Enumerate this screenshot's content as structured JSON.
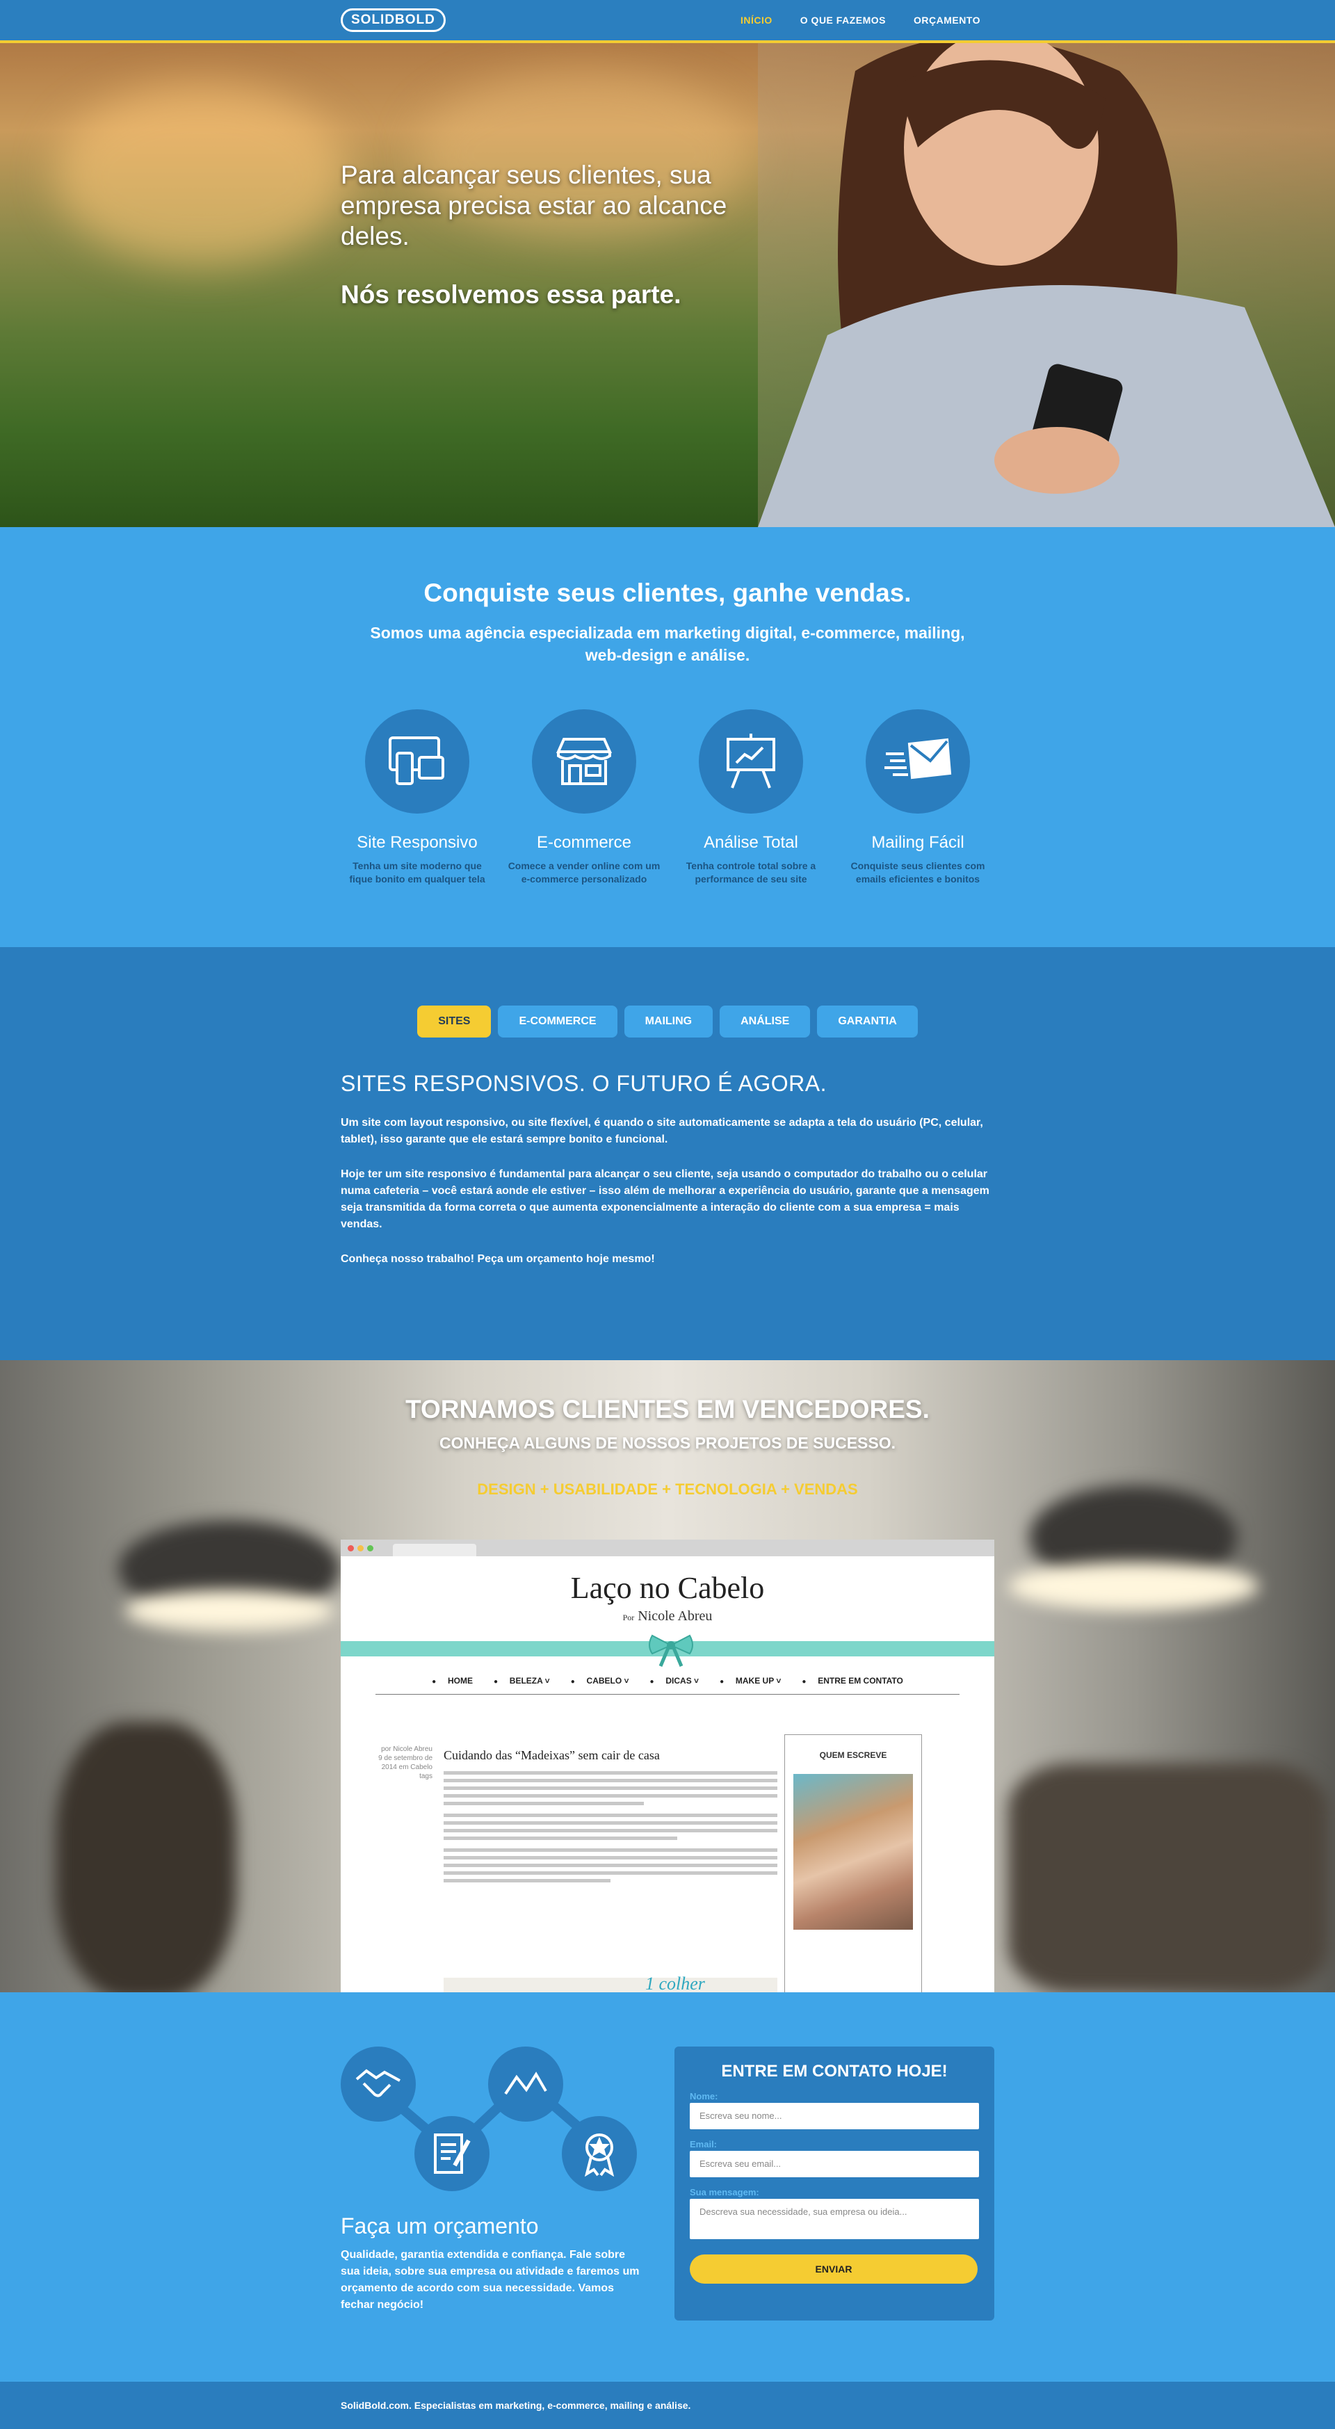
{
  "nav": {
    "logo": "SOLIDBOLD",
    "items": [
      {
        "label": "INÍCIO",
        "active": true
      },
      {
        "label": "O QUE FAZEMOS",
        "active": false
      },
      {
        "label": "ORÇAMENTO",
        "active": false
      }
    ]
  },
  "hero": {
    "headline": "Para alcançar seus clientes, sua empresa precisa estar ao alcance deles.",
    "tagline": "Nós resolvemos essa parte."
  },
  "services": {
    "title": "Conquiste seus clientes, ganhe vendas.",
    "subtitle": "Somos uma agência especializada em marketing digital, e-commerce, mailing, web-design e análise.",
    "items": [
      {
        "icon": "responsive-devices-icon",
        "title": "Site Responsivo",
        "desc": "Tenha um site moderno que fique bonito em qualquer tela"
      },
      {
        "icon": "storefront-icon",
        "title": "E-commerce",
        "desc": "Comece a vender online com um e-commerce personalizado"
      },
      {
        "icon": "presentation-chart-icon",
        "title": "Análise Total",
        "desc": "Tenha controle total sobre a performance de seu site"
      },
      {
        "icon": "envelope-icon",
        "title": "Mailing Fácil",
        "desc": "Conquiste seus clientes com emails eficientes e bonitos"
      }
    ]
  },
  "tabs": {
    "items": [
      {
        "label": "SITES",
        "active": true
      },
      {
        "label": "E-COMMERCE",
        "active": false
      },
      {
        "label": "MAILING",
        "active": false
      },
      {
        "label": "ANÁLISE",
        "active": false
      },
      {
        "label": "GARANTIA",
        "active": false
      }
    ],
    "title": "SITES RESPONSIVOS. O FUTURO É AGORA.",
    "p1": "Um site com layout responsivo, ou site flexível, é quando o site automaticamente se adapta a tela do usuário (PC, celular, tablet), isso garante que ele estará sempre bonito e funcional.",
    "p2": "Hoje ter um site responsivo é fundamental para alcançar o seu cliente, seja usando o computador do trabalho ou o celular numa cafeteria – você estará aonde ele estiver – isso além de melhorar a experiência do usuário, garante que a mensagem seja transmitida da forma correta o que aumenta exponencialmente a interação do cliente com a sua empresa = mais vendas.",
    "p3": "Conheça nosso trabalho! Peça um orçamento hoje mesmo!"
  },
  "portfolio": {
    "title": "TORNAMOS CLIENTES EM VENCEDORES.",
    "subtitle": "CONHEÇA ALGUNS DE NOSSOS PROJETOS DE SUCESSO.",
    "tagline": "DESIGN + USABILIDADE + TECNOLOGIA + VENDAS",
    "blog": {
      "title": "Laço no Cabelo",
      "byline": "Nicole Abreu",
      "by_prefix": "Por",
      "nav": [
        "HOME",
        "BELEZA ˅",
        "CABELO ˅",
        "DICAS ˅",
        "MAKE UP ˅",
        "ENTRE EM CONTATO"
      ],
      "post_title": "Cuidando das “Madeixas” sem cair de casa",
      "sidebar_title": "QUEM ESCREVE",
      "meta": "por Nicole Abreu\n9 de setembro de 2014\nem Cabelo\ntags",
      "colher": "1 colher"
    }
  },
  "contact": {
    "title": "Faça um orçamento",
    "desc": "Qualidade, garantia extendida e confiança. Fale sobre sua ideia, sobre sua empresa ou atividade e faremos um orçamento de acordo com sua necessidade. Vamos fechar negócio!",
    "form": {
      "title": "ENTRE EM CONTATO HOJE!",
      "name_label": "Nome:",
      "name_placeholder": "Escreva seu nome...",
      "email_label": "Email:",
      "email_placeholder": "Escreva seu email...",
      "msg_label": "Sua mensagem:",
      "msg_placeholder": "Descreva sua necessidade, sua empresa ou ideia...",
      "submit": "ENVIAR"
    }
  },
  "footer": {
    "text": "SolidBold.com. Especialistas em marketing, e-commerce, mailing e análise."
  },
  "colors": {
    "accent": "#f5cc32",
    "blue_dark": "#2a7dbe",
    "blue_light": "#3fa5e8"
  }
}
